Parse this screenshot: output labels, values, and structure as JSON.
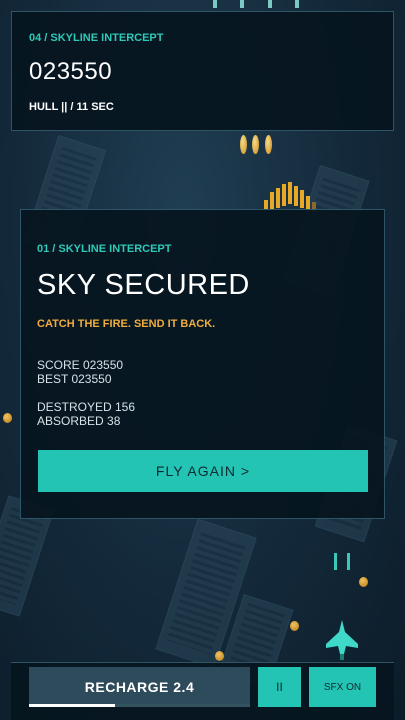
{
  "top_panel": {
    "stage_label": "04 / SKYLINE INTERCEPT",
    "score": "023550",
    "hull_text": "HULL || / 11 SEC"
  },
  "result_panel": {
    "stage_label": "01 / SKYLINE INTERCEPT",
    "headline": "SKY SECURED",
    "tagline": "CATCH THE FIRE. SEND IT BACK.",
    "score_line": "SCORE 023550",
    "best_line": "BEST 023550",
    "destroyed_line": "DESTROYED 156",
    "absorbed_line": "ABSORBED 38",
    "fly_again_label": "FLY AGAIN >"
  },
  "hud": {
    "recharge_label": "RECHARGE 2.4",
    "recharge_progress": 0.39,
    "pause_label": "II",
    "sfx_label": "SFX ON"
  },
  "colors": {
    "accent_teal": "#23c4b4",
    "label_teal": "#2fc9b8",
    "tagline_orange": "#f0ad3e",
    "enemy_gold": "#e7a827",
    "panel_bg": "#06141e"
  },
  "icons": {
    "player_ship": "player-ship-icon",
    "enemy": "enemy-boss-icon"
  }
}
